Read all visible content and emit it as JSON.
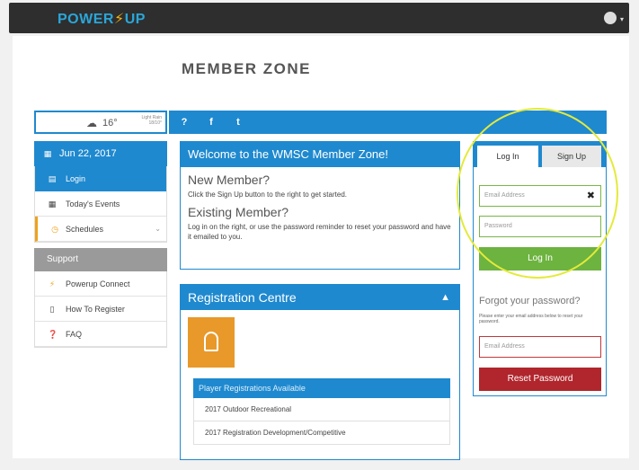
{
  "app": {
    "logo_left": "POWER",
    "logo_bolt": "⚡",
    "logo_right": "UP"
  },
  "page": {
    "title": "MEMBER ZONE"
  },
  "weather": {
    "temperature": "16°",
    "detail": "Light Rain\n18/10°"
  },
  "social": {
    "items": [
      "?",
      "f",
      "t"
    ]
  },
  "sidebar": {
    "date": "Jun 22, 2017",
    "items": [
      {
        "label": "Login"
      },
      {
        "label": "Today's Events"
      },
      {
        "label": "Schedules"
      }
    ],
    "support_label": "Support",
    "support_items": [
      {
        "label": "Powerup Connect"
      },
      {
        "label": "How To Register"
      },
      {
        "label": "FAQ"
      }
    ]
  },
  "welcome": {
    "heading": "Welcome to the WMSC Member Zone!",
    "new_member_title": "New Member?",
    "new_member_text": "Click the Sign Up button to the right to get started.",
    "existing_title": "Existing Member?",
    "existing_text": "Log in on the right, or use the password reminder to reset your password and have it emailed to you."
  },
  "registration": {
    "heading": "Registration Centre",
    "bar_label": "Player Registrations Available",
    "rows": [
      "2017 Outdoor Recreational",
      "2017 Registration Development/Competitive"
    ]
  },
  "login": {
    "tab_login": "Log In",
    "tab_signup": "Sign Up",
    "email_placeholder": "Email Address",
    "password_placeholder": "Password",
    "login_button": "Log In",
    "forgot_title": "Forgot your password?",
    "forgot_note": "Please enter your email address below to reset your password.",
    "reset_email_placeholder": "Email Address",
    "reset_button": "Reset Password"
  },
  "colors": {
    "primary": "#1f89cf",
    "login_green": "#6db33f",
    "reset_red": "#b0262c",
    "highlight": "#e4ea3a",
    "accent_orange": "#e8992a"
  }
}
